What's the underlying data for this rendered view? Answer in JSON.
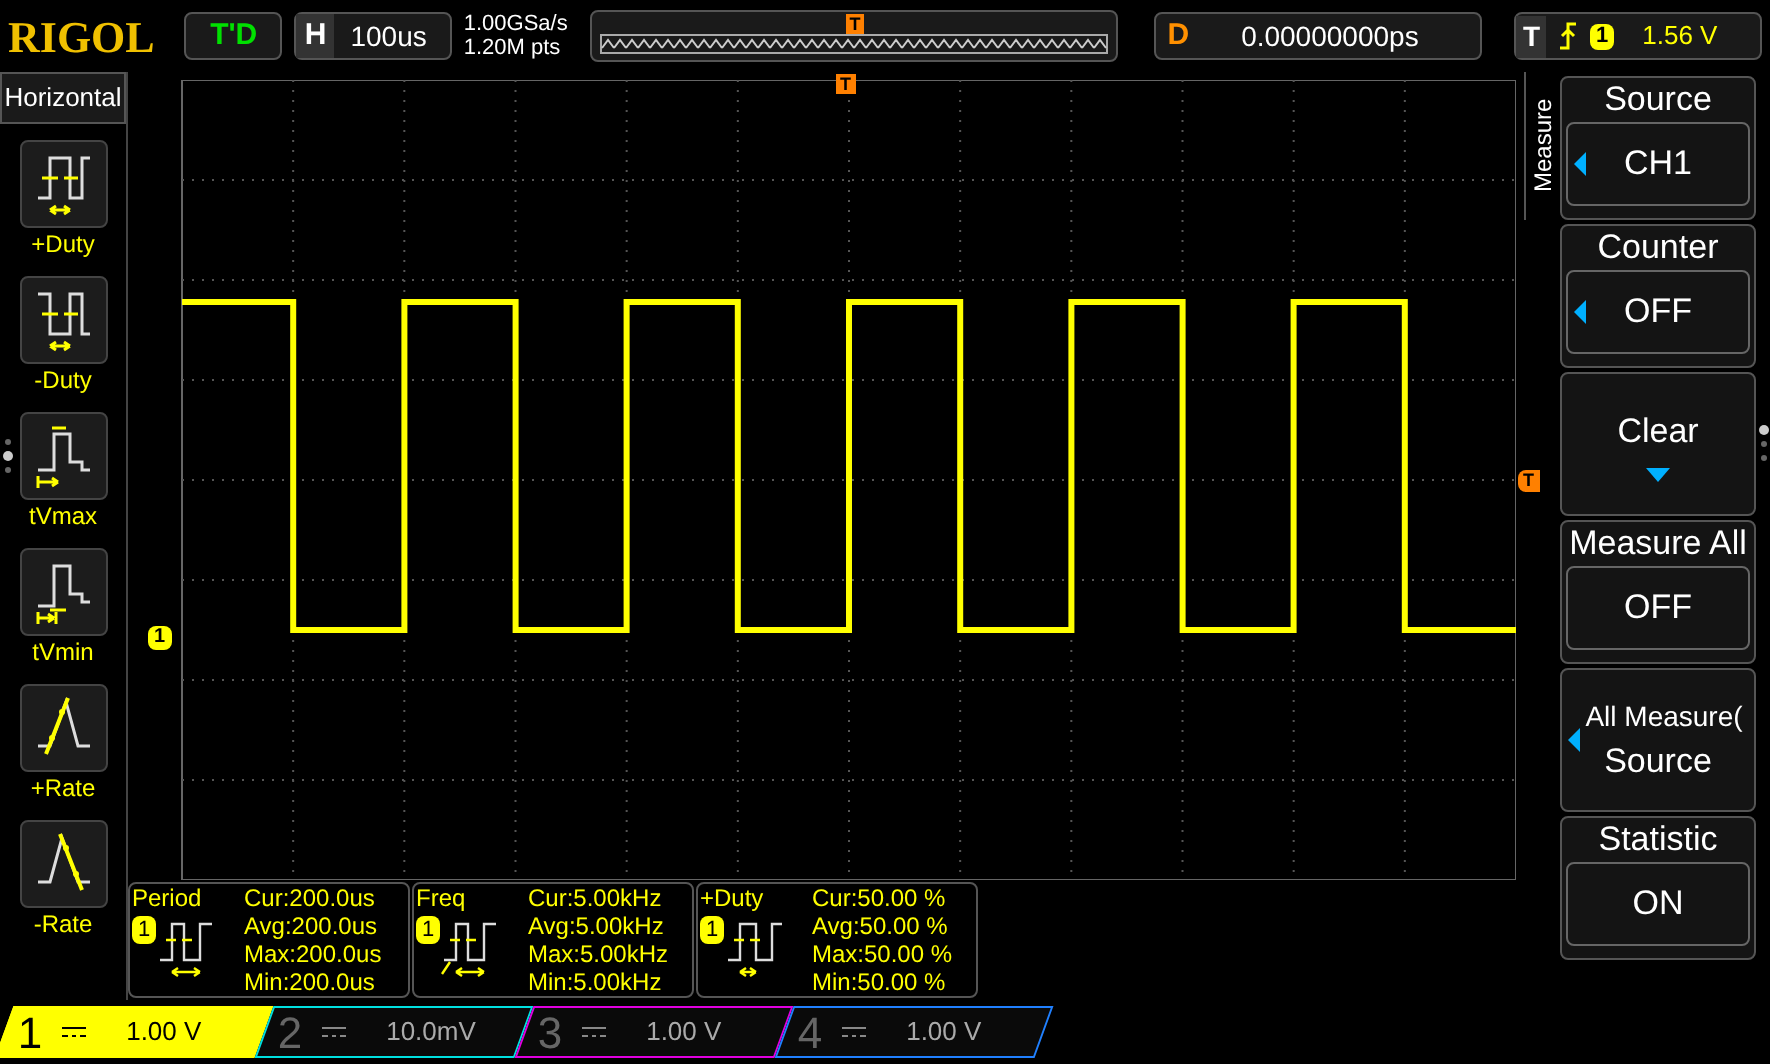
{
  "top_bar": {
    "logo": "RIGOL",
    "run_status": "T'D",
    "timebase": {
      "label": "H",
      "value": "100us"
    },
    "sample_rate": "1.00GSa/s",
    "memory_depth": "1.20M pts",
    "trigger_position_marker": "T",
    "delay": {
      "label": "D",
      "value": "0.00000000ps"
    },
    "trigger": {
      "label": "T",
      "source": "1",
      "level": "1.56 V"
    }
  },
  "left_panel": {
    "title": "Horizontal",
    "items": [
      {
        "kind": "pos-duty",
        "label": "+Duty"
      },
      {
        "kind": "neg-duty",
        "label": "-Duty"
      },
      {
        "kind": "tvmax",
        "label": "tVmax"
      },
      {
        "kind": "tvmin",
        "label": "tVmin"
      },
      {
        "kind": "pos-rate",
        "label": "+Rate"
      },
      {
        "kind": "neg-rate",
        "label": "-Rate"
      }
    ]
  },
  "plot": {
    "channel_marker": "1",
    "trigger_level_marker": "T",
    "trigger_time_marker": "T"
  },
  "measurements": [
    {
      "name": "Period",
      "source": "1",
      "kind": "period",
      "stats": [
        "Cur:200.0us",
        "Avg:200.0us",
        "Max:200.0us",
        "Min:200.0us"
      ]
    },
    {
      "name": "Freq",
      "source": "1",
      "kind": "freq",
      "stats": [
        "Cur:5.00kHz",
        "Avg:5.00kHz",
        "Max:5.00kHz",
        "Min:5.00kHz"
      ]
    },
    {
      "name": "+Duty",
      "source": "1",
      "kind": "duty",
      "stats": [
        "Cur:50.00 %",
        "Avg:50.00 %",
        "Max:50.00 %",
        "Min:50.00 %"
      ]
    }
  ],
  "right_menu": {
    "title": "Measure",
    "items": [
      {
        "kind": "select",
        "title": "Source",
        "value": "CH1"
      },
      {
        "kind": "select",
        "title": "Counter",
        "value": "OFF"
      },
      {
        "kind": "action",
        "title": "Clear"
      },
      {
        "kind": "toggle",
        "title": "Measure All",
        "value": "OFF"
      },
      {
        "kind": "submenu",
        "title": "All Measure(",
        "value": "Source"
      },
      {
        "kind": "toggle",
        "title": "Statistic",
        "value": "ON"
      }
    ]
  },
  "channels": [
    {
      "number": "1",
      "value": "1.00 V",
      "selected": true,
      "color": "#ffff00"
    },
    {
      "number": "2",
      "value": "10.0mV",
      "selected": false,
      "color": "#00e0e0"
    },
    {
      "number": "3",
      "value": "1.00 V",
      "selected": false,
      "color": "#e000e0"
    },
    {
      "number": "4",
      "value": "1.00 V",
      "selected": false,
      "color": "#2080ff"
    }
  ]
}
